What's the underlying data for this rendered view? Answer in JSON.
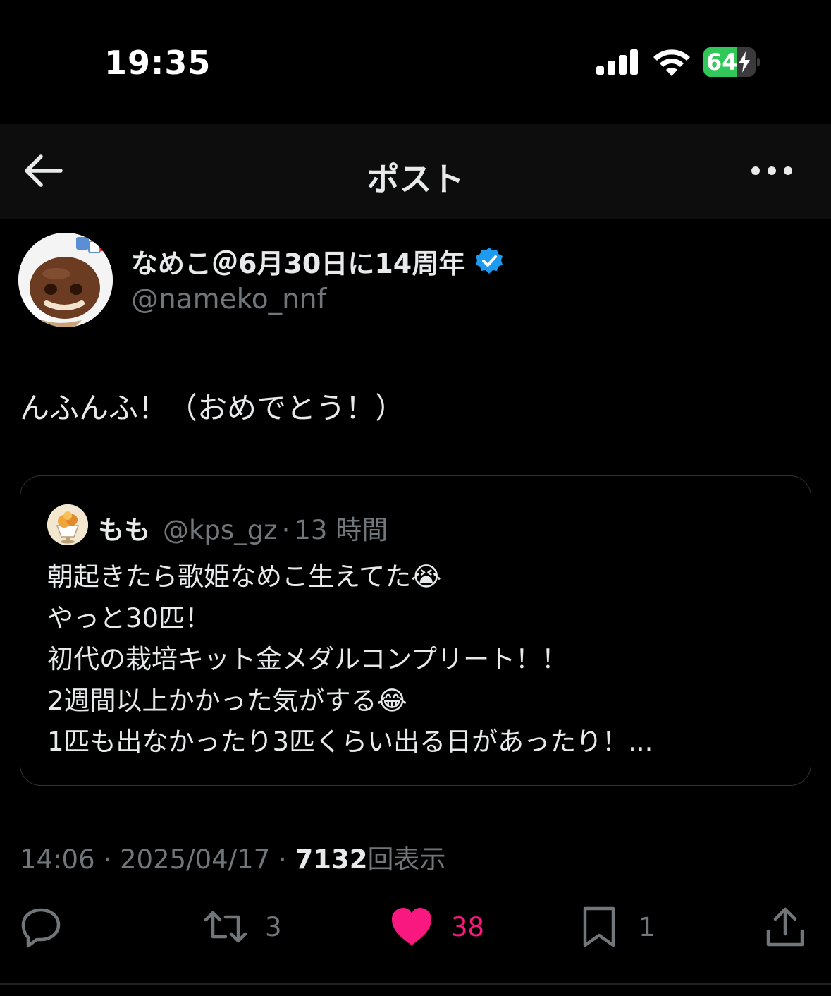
{
  "status_bar": {
    "time": "19:35",
    "battery_level": "64",
    "battery_fraction": 0.64,
    "icons": [
      "signal-icon",
      "wifi-icon",
      "battery-charging-icon"
    ]
  },
  "header": {
    "title": "ポスト",
    "icons": [
      "back-arrow-icon",
      "more-icon"
    ]
  },
  "author": {
    "name": "なめこ＠6月30日に14周年",
    "handle": "@nameko_nnf",
    "verified_icon": "verified-badge-icon"
  },
  "post": {
    "text": "んふんふ！（おめでとう！）"
  },
  "quote": {
    "name": "もも",
    "handle": "@kps_gz",
    "separator": "·",
    "time": "13 時間",
    "lines": [
      "朝起きたら歌姫なめこ生えてた😭",
      "やっと30匹！",
      "初代の栽培キット金メダルコンプリート！！",
      "2週間以上かかった気がする😂",
      "1匹も出なかったり3匹くらい出る日があったり！..."
    ]
  },
  "meta": {
    "time": "14:06",
    "date": "2025/04/17",
    "views": "7132",
    "views_label": "回表示",
    "separator": "·"
  },
  "actions": {
    "reply_count": "",
    "repost_count": "3",
    "like_count": "38",
    "bookmark_count": "1",
    "icons": [
      "reply-icon",
      "repost-icon",
      "heart-icon",
      "bookmark-icon",
      "share-icon"
    ]
  },
  "colors": {
    "background": "#000000",
    "text_primary": "#e7e9ea",
    "text_secondary": "#71767b",
    "like_pink": "#f91880",
    "verified_blue": "#1d9bf0",
    "battery_green": "#32c759"
  }
}
